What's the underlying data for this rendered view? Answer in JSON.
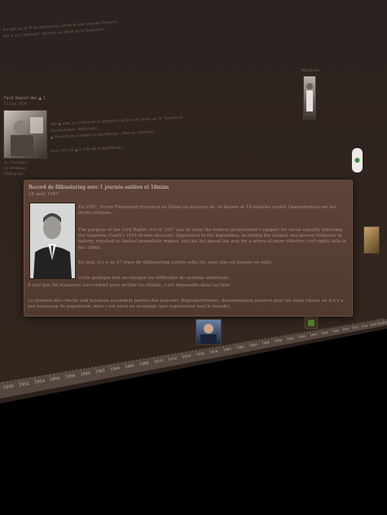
{
  "page": {
    "background_top": "#2d2320",
    "background_bottom": "#000000"
  },
  "background_text": {
    "top_line_1": "Il s'agit sur le fil de discours au Sénat le plus long de l'histoire...",
    "top_line_2": "fait il, en s'inclinant, discours au Sénat de la législation...",
    "event_title": "Fault Report des ▲ 1",
    "event_date": "15 juin 1970",
    "event_line_1": "Hot ▲ aide, ce mobile de la défense (Caroline de Tullo) par le 'Senatorial'...",
    "event_line_2": "Senate/Labor, Diplomatic...",
    "event_line_3": "▲ Ministre de la Santé et des Affaires - Mise en mémoire...",
    "event_line_4": "Lors, Fort De ▲ 1, 24e de la législature...",
    "side_note_1": "Au 3 octobre",
    "side_note_2": "Le sénateur",
    "side_note_3": "CNN quart",
    "side_label": "Manifeste"
  },
  "popup": {
    "title": "Record de filibustering avec 1 journée entière et 18mins",
    "date": "28 août 1957",
    "para1": "En 1957, Strom Thurmond prononce au Sénat un discours de 24 heures et 18 minutes contre l'amendement sur les droits civiques.",
    "para2": "The purpose of the Civil Rights Act of 1957 was to show the federal government's support for racial equality following the Supreme Court's 1954 Brown decision. Opposition to the legislation, including the longest one-person filibuster in history, resulted in limited immediate impact, but the Act paved the way for a series of more effective civil rights bills in the 1960s.",
    "para3": "En tout, il y a eu 57 jours de filibustering contre cette loi, mais elle est passée en suite.",
    "para4_line1": "Cette pratique met en exergue les difficultés du système américain.",
    "para4_line2": "Il faut que 60 sénateurs s'accordent pour arrêter les débats, c'est impossible dans les faits.",
    "para5": "Le système des checks and balances accordent parfois des pouvoirs disproportionnés, discrimination positive pour les états ruraux où il n'y a pas beaucoup de population, mais c'est aussi un avantage (pas représenter tout le monde)."
  },
  "timeline": {
    "years": [
      "1950",
      "1952",
      "1954",
      "1956",
      "1958",
      "1960",
      "1962",
      "1964",
      "1966",
      "1968",
      "1970",
      "1972",
      "1974",
      "1976",
      "1978",
      "1980",
      "1982",
      "1984",
      "1986",
      "1988",
      "1990",
      "1992",
      "1994",
      "1996",
      "1998",
      "2000",
      "2002",
      "2004",
      "2006",
      "2008",
      "2010"
    ]
  },
  "icons": {
    "portrait": "senator-portrait-photo",
    "thumbs": [
      "news-photo-thumbnail",
      "speaker-photo-thumbnail",
      "politician-photo-thumbnail",
      "group-photo-thumbnail",
      "circle-badge-icon"
    ]
  }
}
